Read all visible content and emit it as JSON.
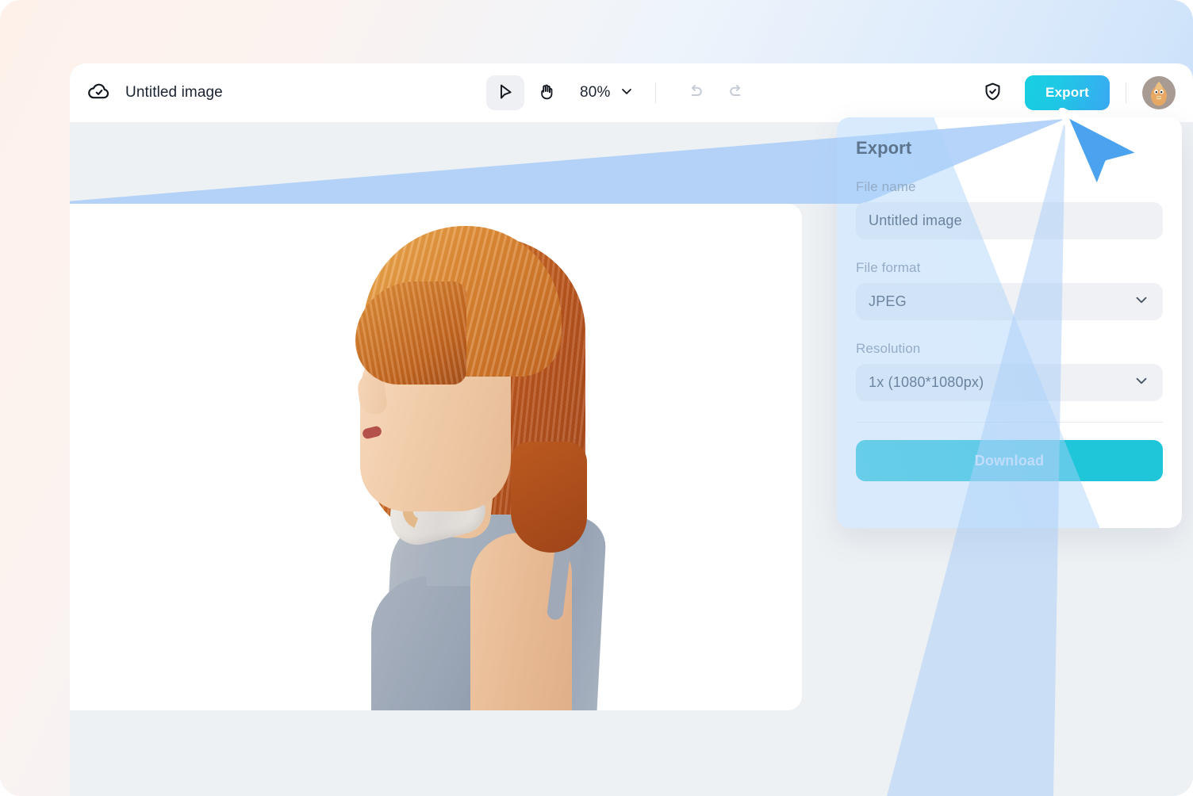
{
  "app": {
    "window_title": "Untitled image",
    "cloud_status_icon": "cloud-check-icon"
  },
  "toolbar": {
    "select_tool_icon": "cursor-arrow-icon",
    "hand_tool_icon": "hand-icon",
    "zoom_level": "80%",
    "zoom_chevron_icon": "chevron-down-icon",
    "undo_icon": "undo-icon",
    "redo_icon": "redo-icon",
    "shield_icon": "shield-check-icon",
    "export_label": "Export",
    "avatar_icon": "user-avatar"
  },
  "export_panel": {
    "title": "Export",
    "file_name": {
      "label": "File name",
      "value": "Untitled image",
      "placeholder": "Untitled image"
    },
    "file_format": {
      "label": "File format",
      "value": "JPEG",
      "chevron_icon": "chevron-down-icon"
    },
    "resolution": {
      "label": "Resolution",
      "value": "1x (1080*1080px)",
      "chevron_icon": "chevron-down-icon"
    },
    "download_label": "Download"
  },
  "canvas": {
    "subject": "woman in profile with red bob haircut, background removed"
  },
  "colors": {
    "export_gradient_start": "#17cfe0",
    "export_gradient_end": "#3aa9f2",
    "download_button": "#1fc5d8",
    "cursor_blue": "#4ba3f0",
    "beam_blue": "#a8cdf7",
    "panel_background": "#ffffff",
    "field_background": "#eff1f4",
    "app_background": "#eef1f4",
    "backdrop_warm": "#fdf1ea",
    "backdrop_cool": "#bcd9f7",
    "label_gray": "#7c8796",
    "text_dark": "#17202e"
  }
}
